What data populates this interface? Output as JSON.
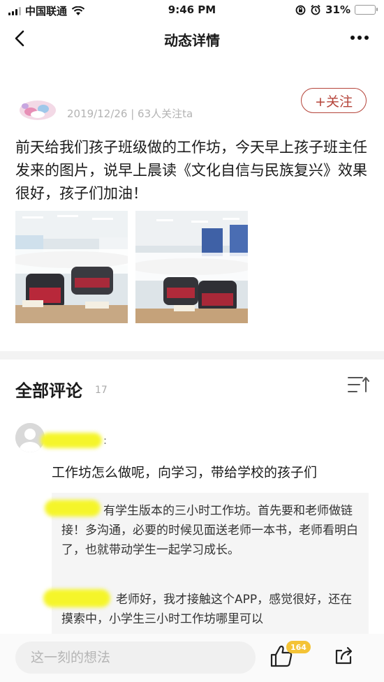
{
  "status_bar": {
    "carrier": "中国联通",
    "time": "9:46 PM",
    "battery": "31%",
    "battery_level": 0.31
  },
  "nav": {
    "title": "动态详情"
  },
  "post": {
    "date_follow": "2019/12/26 | 63人关注ta",
    "follow_label": "+关注",
    "text": "前天给我们孩子班级做的工作坊，今天早上孩子班主任发来的图片，说早上晨读《文化自信与民族复兴》效果很好，孩子们加油！",
    "photo_count": 2
  },
  "comments": {
    "title": "全部评论",
    "count": "17",
    "items": [
      {
        "colon": ":",
        "text": "工作坊怎么做呢，向学习，带给学校的孩子们",
        "replies": [
          {
            "text": "有学生版本的三小时工作坊。首先要和老师做链接！多沟通，必要的时候见面送老师一本书，老师看明白了，也就带动学生一起学习成长。"
          },
          {
            "text": "老师好，我才接触这个APP，感觉很好，还在摸索中，小学生三小时工作坊哪里可以"
          }
        ]
      }
    ]
  },
  "bottom_bar": {
    "input_placeholder": "这一刻的想法",
    "like_count": "164"
  },
  "colors": {
    "accent": "#b5443a",
    "badge": "#f4c336",
    "battery_fill": "#f5c518",
    "divider": "#f3f3f3",
    "reply_bg": "#f5f5f5"
  },
  "icons": {
    "back": "chevron-left-icon",
    "more": "more-dots-icon",
    "sort": "sort-icon",
    "like": "thumb-up-icon",
    "share": "share-icon",
    "wifi": "wifi-icon",
    "alarm": "alarm-icon",
    "lock_rotation": "rotation-lock-icon"
  }
}
